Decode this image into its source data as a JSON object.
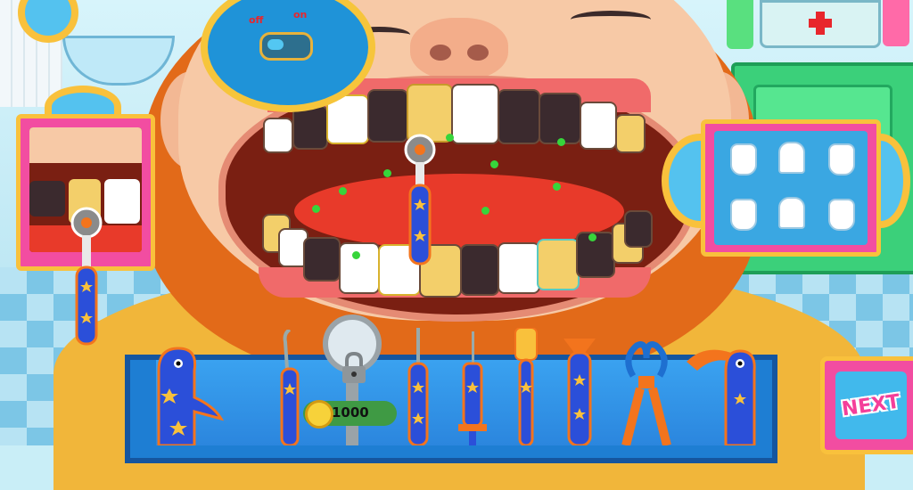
{
  "game": {
    "headlamp": {
      "off_label": "off",
      "on_label": "on"
    },
    "coins": {
      "amount": "1000"
    },
    "next_button": {
      "label": "NEXT"
    },
    "colors": {
      "accent_pink": "#f24da1",
      "accent_gold": "#f9c13c",
      "tray_blue": "#1e7ed3",
      "germ_green": "#37d53b"
    },
    "tools": [
      {
        "name": "bird-drill-tool"
      },
      {
        "name": "probe-tool"
      },
      {
        "name": "laser-tool-locked"
      },
      {
        "name": "pick-tool"
      },
      {
        "name": "syringe-tool"
      },
      {
        "name": "toothbrush-tool"
      },
      {
        "name": "drill-tool"
      },
      {
        "name": "pliers-tool"
      },
      {
        "name": "hook-bird-tool"
      }
    ],
    "icons": {
      "first_aid": "first-aid-icon",
      "lock": "lock-icon",
      "coin": "coin-icon",
      "magnifier": "zoom-magnifier-icon"
    }
  }
}
